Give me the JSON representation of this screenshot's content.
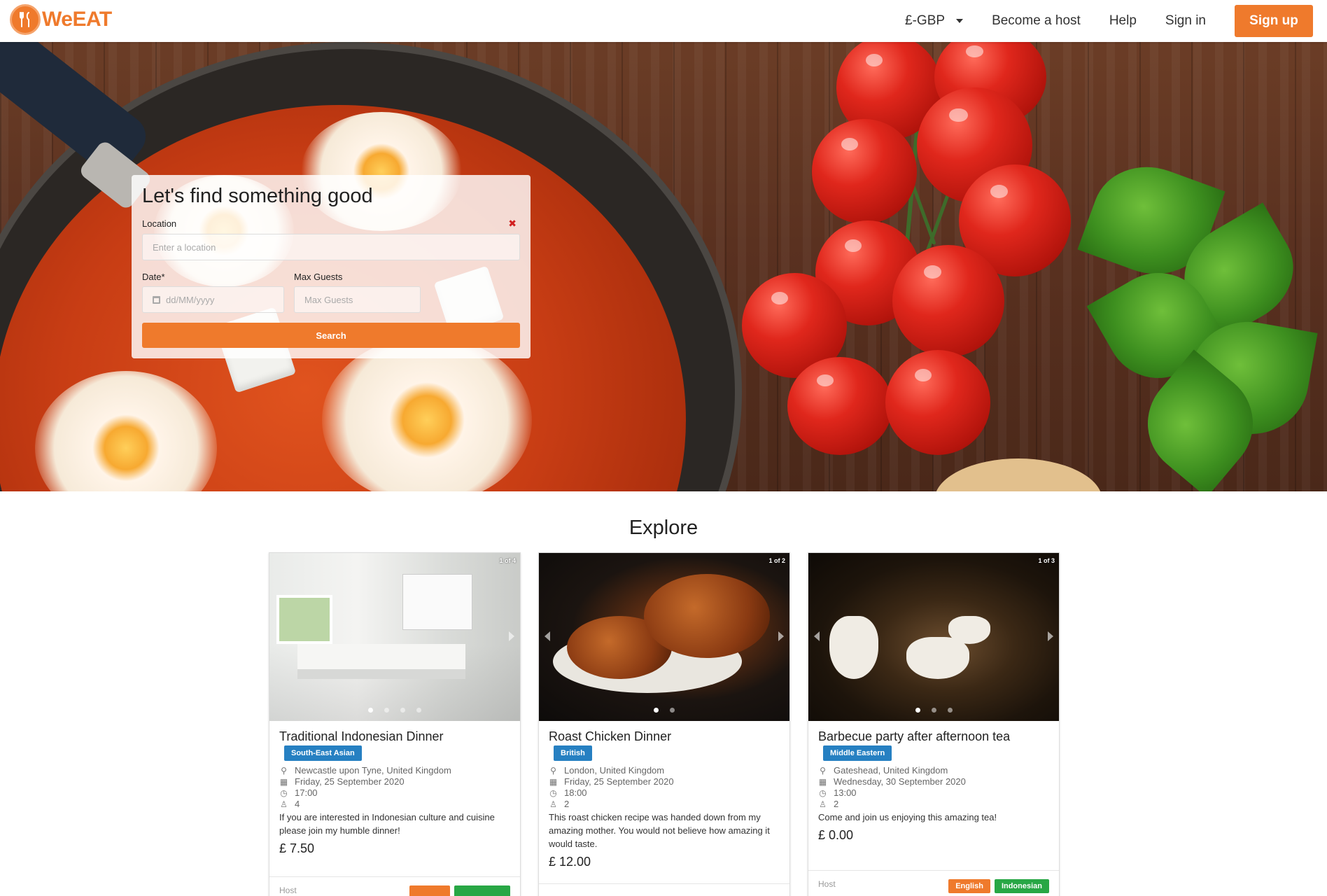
{
  "nav": {
    "logo_text": "WeEAT",
    "currency": "£-GBP",
    "become_host": "Become a host",
    "help": "Help",
    "sign_in": "Sign in",
    "sign_up": "Sign up",
    "accent": "#ef7a2c"
  },
  "search": {
    "title": "Let's find something good",
    "location_label": "Location",
    "location_placeholder": "Enter a location",
    "date_label": "Date*",
    "date_placeholder": "dd/MM/yyyy",
    "guests_label": "Max Guests",
    "guests_placeholder": "Max Guests",
    "button": "Search"
  },
  "explore": {
    "title": "Explore",
    "cards": [
      {
        "counter": "1 of 4",
        "title": "Traditional Indonesian Dinner",
        "tag": "South-East Asian",
        "location": "Newcastle upon Tyne, United Kingdom",
        "date": "Friday, 25 September 2020",
        "time": "17:00",
        "guests": "4",
        "description": "If you are interested in Indonesian culture and cuisine please join my humble dinner!",
        "price": "£ 7.50",
        "host_label": "Host",
        "languages": [
          "",
          ""
        ]
      },
      {
        "counter": "1 of 2",
        "title": "Roast Chicken Dinner",
        "tag": "British",
        "location": "London, United Kingdom",
        "date": "Friday, 25 September 2020",
        "time": "18:00",
        "guests": "2",
        "description": "This roast chicken recipe was handed down from my amazing mother. You would not believe how amazing it would taste.",
        "price": "£ 12.00",
        "host_label": "",
        "languages": []
      },
      {
        "counter": "1 of 3",
        "title": "Barbecue party after afternoon tea",
        "tag": "Middle Eastern",
        "location": "Gateshead, United Kingdom",
        "date": "Wednesday, 30 September 2020",
        "time": "13:00",
        "guests": "2",
        "description": "Come and join us enjoying this amazing tea!",
        "price": "£ 0.00",
        "host_label": "Host",
        "languages": [
          "English",
          "Indonesian"
        ]
      }
    ]
  }
}
